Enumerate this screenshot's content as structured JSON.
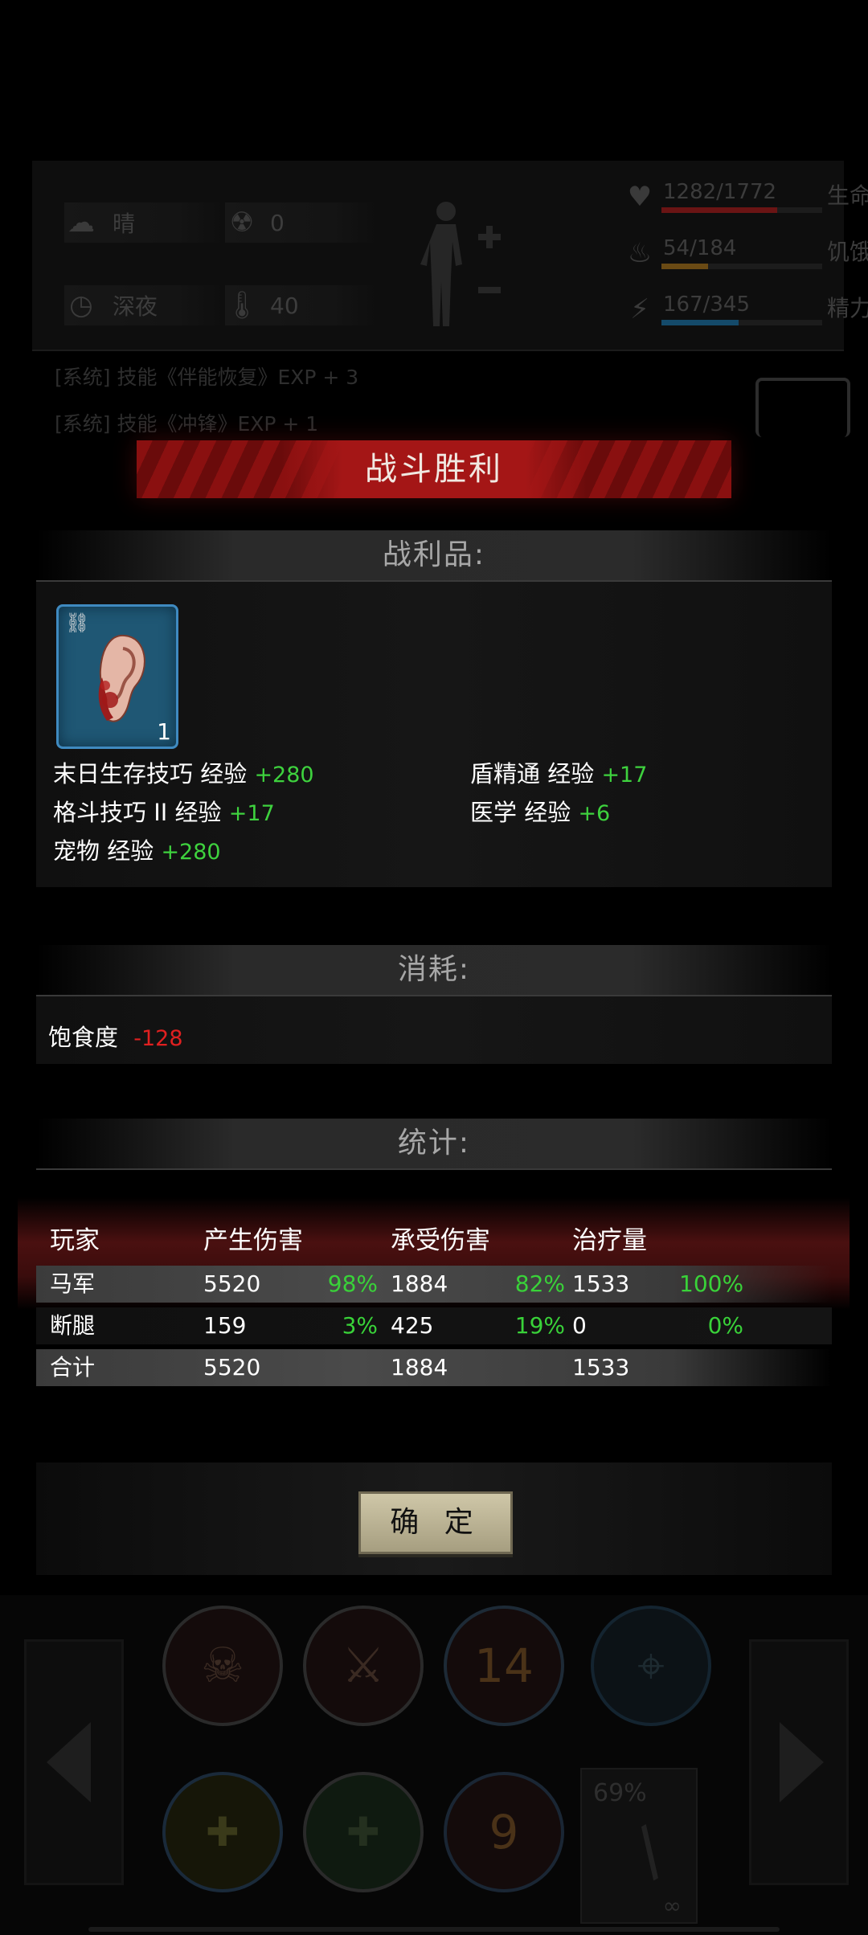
{
  "hud": {
    "weather": "晴",
    "radiation": "0",
    "time_of_day": "深夜",
    "temperature": "40",
    "vitals": [
      {
        "value": "1282/1772",
        "label": "生命",
        "fraction": 0.72,
        "color": "#6a1414"
      },
      {
        "value": "54/184",
        "label": "饥饿",
        "fraction": 0.29,
        "color": "#6a4a14"
      },
      {
        "value": "167/345",
        "label": "精力",
        "fraction": 0.48,
        "color": "#144a6a"
      }
    ],
    "log": [
      "[系统] 技能《伴能恢复》EXP + 3",
      "[系统] 技能《冲锋》EXP + 1"
    ]
  },
  "dialog": {
    "title": "战斗胜利",
    "loot_header": "战利品:",
    "item": {
      "name": "ear-icon",
      "qty": "1"
    },
    "exp": [
      {
        "skill": "末日生存技巧 经验",
        "gain": "+280"
      },
      {
        "skill": "盾精通 经验",
        "gain": "+17"
      },
      {
        "skill": "格斗技巧 II 经验",
        "gain": "+17"
      },
      {
        "skill": "医学 经验",
        "gain": "+6"
      },
      {
        "skill": "宠物 经验",
        "gain": "+280"
      }
    ],
    "consume_header": "消耗:",
    "consume": {
      "label": "饱食度",
      "value": "-128"
    },
    "stats_header": "统计:",
    "columns": [
      "玩家",
      "产生伤害",
      "承受伤害",
      "治疗量"
    ],
    "rows": [
      {
        "name": "马军",
        "dmg": "5520",
        "dmg_pct": "98%",
        "taken": "1884",
        "taken_pct": "82%",
        "heal": "1533",
        "heal_pct": "100%"
      },
      {
        "name": "断腿",
        "dmg": "159",
        "dmg_pct": "3%",
        "taken": "425",
        "taken_pct": "19%",
        "heal": "0",
        "heal_pct": "0%"
      },
      {
        "name": "合计",
        "dmg": "5520",
        "dmg_pct": "",
        "taken": "1884",
        "taken_pct": "",
        "heal": "1533",
        "heal_pct": ""
      }
    ],
    "confirm": "确 定"
  },
  "skills": {
    "cooldown": "14",
    "count": "9",
    "weapon_durability": "69%",
    "ammo": "∞"
  }
}
